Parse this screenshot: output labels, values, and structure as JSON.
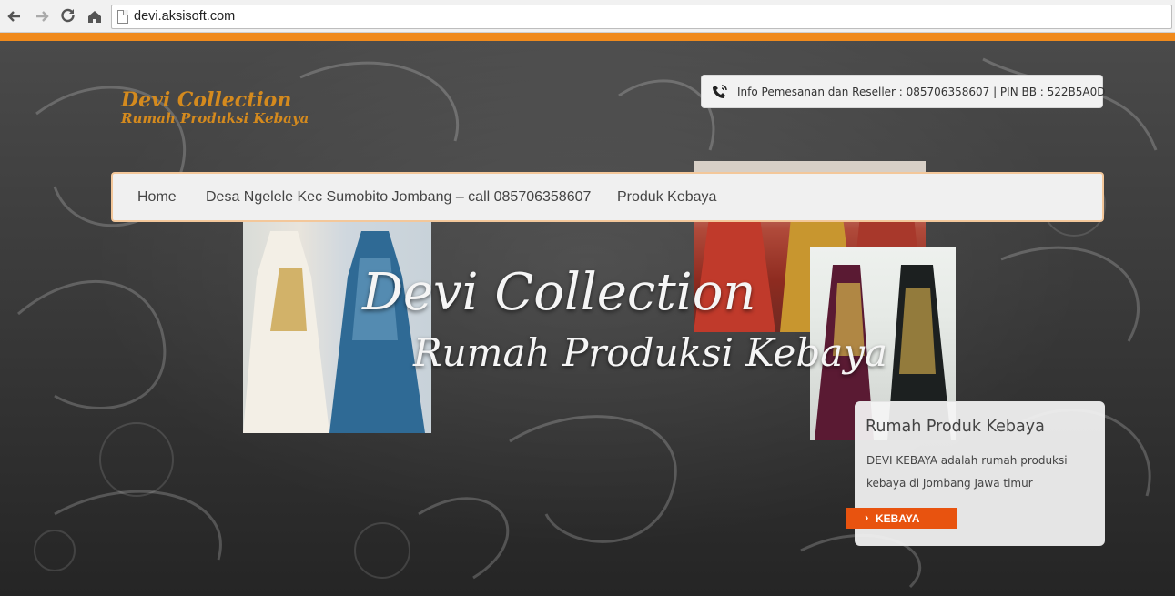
{
  "browser": {
    "url": "devi.aksisoft.com",
    "back_icon": "back-arrow-icon",
    "forward_icon": "forward-arrow-icon",
    "reload_icon": "reload-icon",
    "home_icon": "home-icon"
  },
  "header": {
    "logo_line1": "Devi Collection",
    "logo_line2": "Rumah Produksi Kebaya",
    "info_text": "Info Pemesanan dan Reseller : 085706358607 | PIN BB : 522B5A0D"
  },
  "menu": {
    "items": [
      {
        "label": "Home"
      },
      {
        "label": "Desa Ngelele Kec Sumobito Jombang – call 085706358607"
      },
      {
        "label": "Produk Kebaya"
      }
    ]
  },
  "hero": {
    "headline1": "Devi Collection",
    "headline2": "Rumah Produksi Kebaya"
  },
  "card": {
    "title": "Rumah Produk Kebaya",
    "desc": "DEVI KEBAYA adalah rumah produksi kebaya di Jombang Jawa timur",
    "button_label": "KEBAYA"
  },
  "colors": {
    "accent_orange": "#f08a1c",
    "button_orange": "#e8530f",
    "logo_gold": "#d48a1e"
  }
}
